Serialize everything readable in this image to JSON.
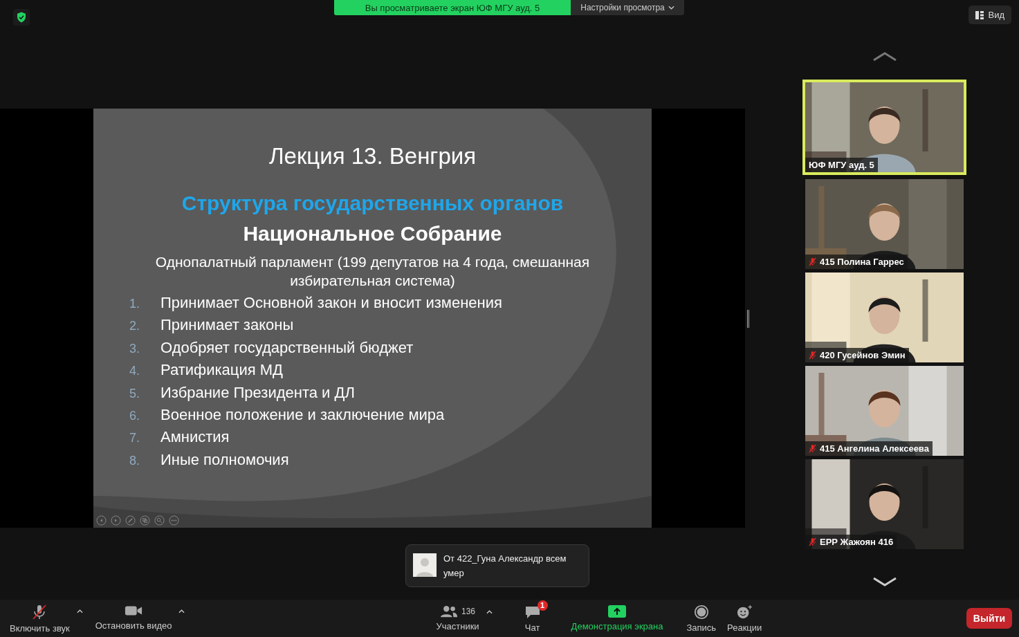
{
  "banner": {
    "text": "Вы просматриваете экран ЮФ МГУ ауд. 5",
    "settings": "Настройки просмотра"
  },
  "view_button": "Вид",
  "slide": {
    "title": "Лекция 13. Венгрия",
    "subtitle": "Структура государственных органов",
    "heading": "Национальное Собрание",
    "intro": "Однопалатный парламент (199 депутатов на 4 года, смешанная избирательная система)",
    "items": [
      {
        "number": "1.",
        "text": "Принимает Основной закон и вносит изменения"
      },
      {
        "number": "2.",
        "text": "Принимает законы"
      },
      {
        "number": "3.",
        "text": "Одобряет государственный бюджет"
      },
      {
        "number": "4.",
        "text": "Ратификация МД"
      },
      {
        "number": "5.",
        "text": "Избрание Президента и ДЛ"
      },
      {
        "number": "6.",
        "text": "Военное положение и заключение мира"
      },
      {
        "number": "7.",
        "text": "Амнистия"
      },
      {
        "number": "8.",
        "text": "Иные полномочия"
      }
    ]
  },
  "participants": [
    {
      "name": "ЮФ МГУ ауд. 5",
      "speaking": true,
      "muted": false
    },
    {
      "name": "415 Полина Гаррес",
      "speaking": false,
      "muted": true
    },
    {
      "name": "420 Гусейнов Эмин",
      "speaking": false,
      "muted": true
    },
    {
      "name": "415 Ангелина Алексеева",
      "speaking": false,
      "muted": true
    },
    {
      "name": "ЕРР Жажоян 416",
      "speaking": false,
      "muted": true
    }
  ],
  "chat_popup": {
    "header": "От 422_Гуна Александр всем",
    "message": "умер"
  },
  "toolbar": {
    "unmute": "Включить звук",
    "stop_video": "Остановить видео",
    "participants": "Участники",
    "participants_count": "136",
    "chat": "Чат",
    "chat_badge": "1",
    "share": "Демонстрация экрана",
    "record": "Запись",
    "reactions": "Реакции",
    "leave": "Выйти"
  }
}
